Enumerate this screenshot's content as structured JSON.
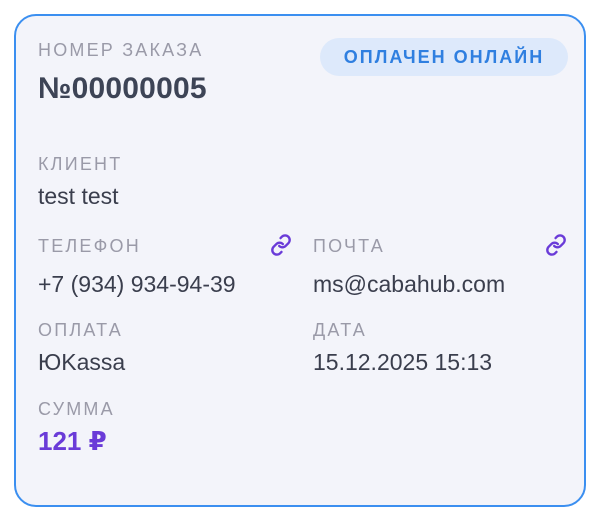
{
  "order": {
    "number_label": "НОМЕР ЗАКАЗА",
    "number": "№00000005",
    "status": "ОПЛАЧЕН ОНЛАЙН"
  },
  "client": {
    "label": "КЛИЕНТ",
    "value": "test test"
  },
  "phone": {
    "label": "ТЕЛЕФОН",
    "value": "+7 (934) 934-94-39",
    "icon": "link-icon"
  },
  "email": {
    "label": "ПОЧТА",
    "value": "ms@cabahub.com",
    "icon": "link-icon"
  },
  "payment": {
    "label": "ОПЛАТА",
    "value": "ЮKassa"
  },
  "date": {
    "label": "ДАТА",
    "value": "15.12.2025 15:13"
  },
  "amount": {
    "label": "СУММА",
    "value": "121 ₽"
  },
  "colors": {
    "card_border": "#3b8ff0",
    "card_background": "#f3f4fa",
    "badge_background": "#dde9fb",
    "badge_text": "#2f7fe0",
    "amount_text": "#6a3bd8",
    "link_icon": "#6a3bd8"
  }
}
